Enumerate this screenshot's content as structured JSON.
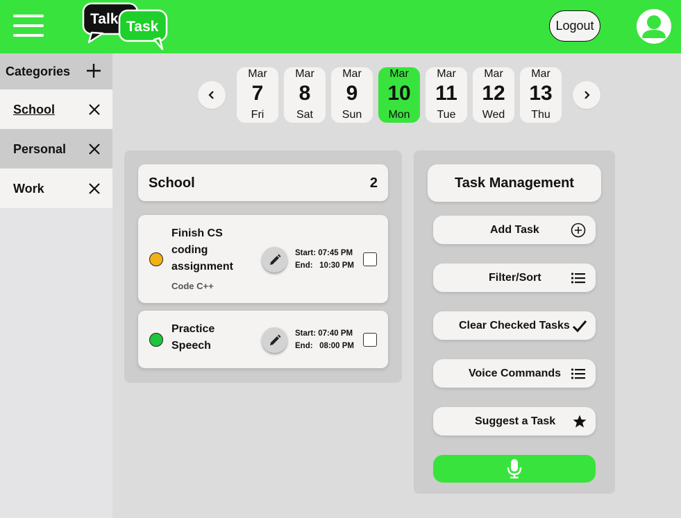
{
  "colors": {
    "accent": "#39e33d",
    "card": "#f4f3f1",
    "panel": "#cdcdcd",
    "sidebar_header": "#cbcbcb"
  },
  "header": {
    "logo_top": "Talk",
    "logo_bottom": "Task",
    "logout_label": "Logout"
  },
  "sidebar": {
    "title": "Categories",
    "items": [
      {
        "label": "School"
      },
      {
        "label": "Personal"
      },
      {
        "label": "Work"
      }
    ]
  },
  "dates": [
    {
      "month": "Mar",
      "day": "7",
      "weekday": "Fri"
    },
    {
      "month": "Mar",
      "day": "8",
      "weekday": "Sat"
    },
    {
      "month": "Mar",
      "day": "9",
      "weekday": "Sun"
    },
    {
      "month": "Mar",
      "day": "10",
      "weekday": "Mon",
      "selected": true
    },
    {
      "month": "Mar",
      "day": "11",
      "weekday": "Tue"
    },
    {
      "month": "Mar",
      "day": "12",
      "weekday": "Wed"
    },
    {
      "month": "Mar",
      "day": "13",
      "weekday": "Thu"
    }
  ],
  "task_list": {
    "title": "School",
    "count": "2",
    "tasks": [
      {
        "name_lines": [
          "Finish CS",
          "coding",
          "assignment"
        ],
        "subtitle": "Code C++",
        "start_label": "Start:",
        "start": "07:45 PM",
        "end_label": "End:",
        "end": "10:30 PM",
        "priority_color": "#f2b215"
      },
      {
        "name_lines": [
          "Practice",
          "Speech"
        ],
        "subtitle": "",
        "start_label": "Start:",
        "start": "07:40 PM",
        "end_label": "End:",
        "end": "08:00 PM",
        "priority_color": "#1fc53c"
      }
    ]
  },
  "management": {
    "title": "Task Management",
    "buttons": [
      {
        "label": "Add Task",
        "icon": "plus-circle-icon"
      },
      {
        "label": "Filter/Sort",
        "icon": "list-icon"
      },
      {
        "label": "Clear Checked Tasks",
        "icon": "checkmark-icon"
      },
      {
        "label": "Voice Commands",
        "icon": "list-icon"
      },
      {
        "label": "Suggest a Task",
        "icon": "star-icon"
      }
    ],
    "mic_icon": "microphone-icon"
  }
}
